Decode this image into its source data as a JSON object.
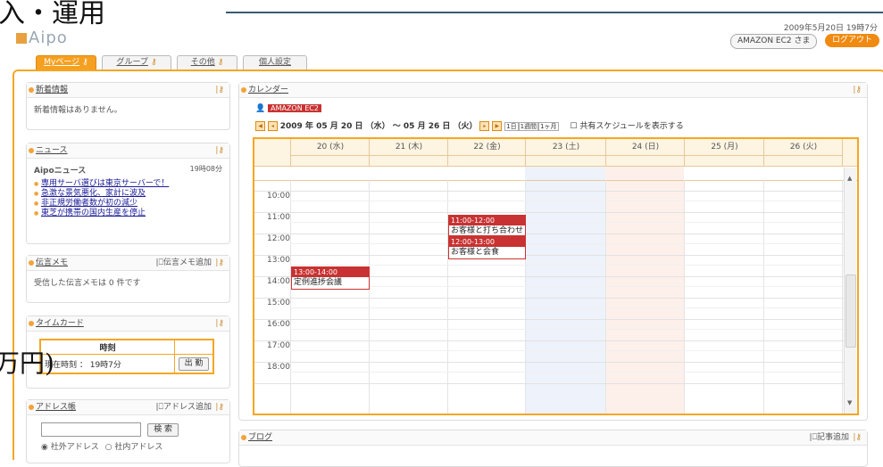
{
  "background_text": {
    "title_fragment": "入・運用",
    "yen_fragment": "万円)"
  },
  "header": {
    "logo": "Aipo",
    "datetime": "2009年5月20日 19時7分",
    "user": "AMAZON EC2 さま",
    "logout": "ログアウト"
  },
  "tabs": [
    {
      "label": "Myページ"
    },
    {
      "label": "グループ"
    },
    {
      "label": "その他"
    },
    {
      "label": "個人設定"
    }
  ],
  "portlets": {
    "whatsnew": {
      "title": "新着情報",
      "message": "新着情報はありません。"
    },
    "news": {
      "title": "ニュース",
      "source": "Aipoニュース",
      "time": "19時08分",
      "items": [
        "専用サーバ選びは東京サーバーで！",
        "急激な景気悪化、家計に波及",
        "非正規労働者数が初の減少",
        "東芝が携帯の国内生産を停止"
      ]
    },
    "memo": {
      "title": "伝言メモ",
      "add": "伝言メモ追加",
      "message": "受信した伝言メモは 0 件です"
    },
    "timecard": {
      "title": "タイムカード",
      "col_header": "時刻",
      "current": "現在時刻 ： 19時7分",
      "punch_button": "出 勤"
    },
    "address": {
      "title": "アドレス帳",
      "add": "アドレス追加",
      "search_button": "検 索",
      "search_value": "",
      "radio_external": "社外アドレス",
      "radio_internal": "社内アドレス"
    },
    "blog": {
      "title": "ブログ",
      "add": "記事追加"
    }
  },
  "calendar": {
    "title": "カレンダー",
    "owner": "AMAZON EC2",
    "range": "2009 年 05 月 20 日 （水） ～ 05 月 26 日 （火）",
    "view_buttons": [
      "1日",
      "1週間",
      "1ヶ月"
    ],
    "shared_label": "共有スケジュールを表示する",
    "days": [
      "20 (水)",
      "21 (木)",
      "22 (金)",
      "23 (土)",
      "24 (日)",
      "25 (月)",
      "26 (火)"
    ],
    "hours": [
      "10:00",
      "11:00",
      "12:00",
      "13:00",
      "14:00",
      "15:00",
      "16:00",
      "17:00",
      "18:00"
    ],
    "events": [
      {
        "day": "22 (金)",
        "time": "11:00-12:00",
        "title": "お客様と打ち合わせ"
      },
      {
        "day": "22 (金)",
        "time": "12:00-13:00",
        "title": "お客様と会食"
      },
      {
        "day": "20 (水)",
        "time": "13:00-14:00",
        "title": "定例進捗会議"
      }
    ]
  }
}
